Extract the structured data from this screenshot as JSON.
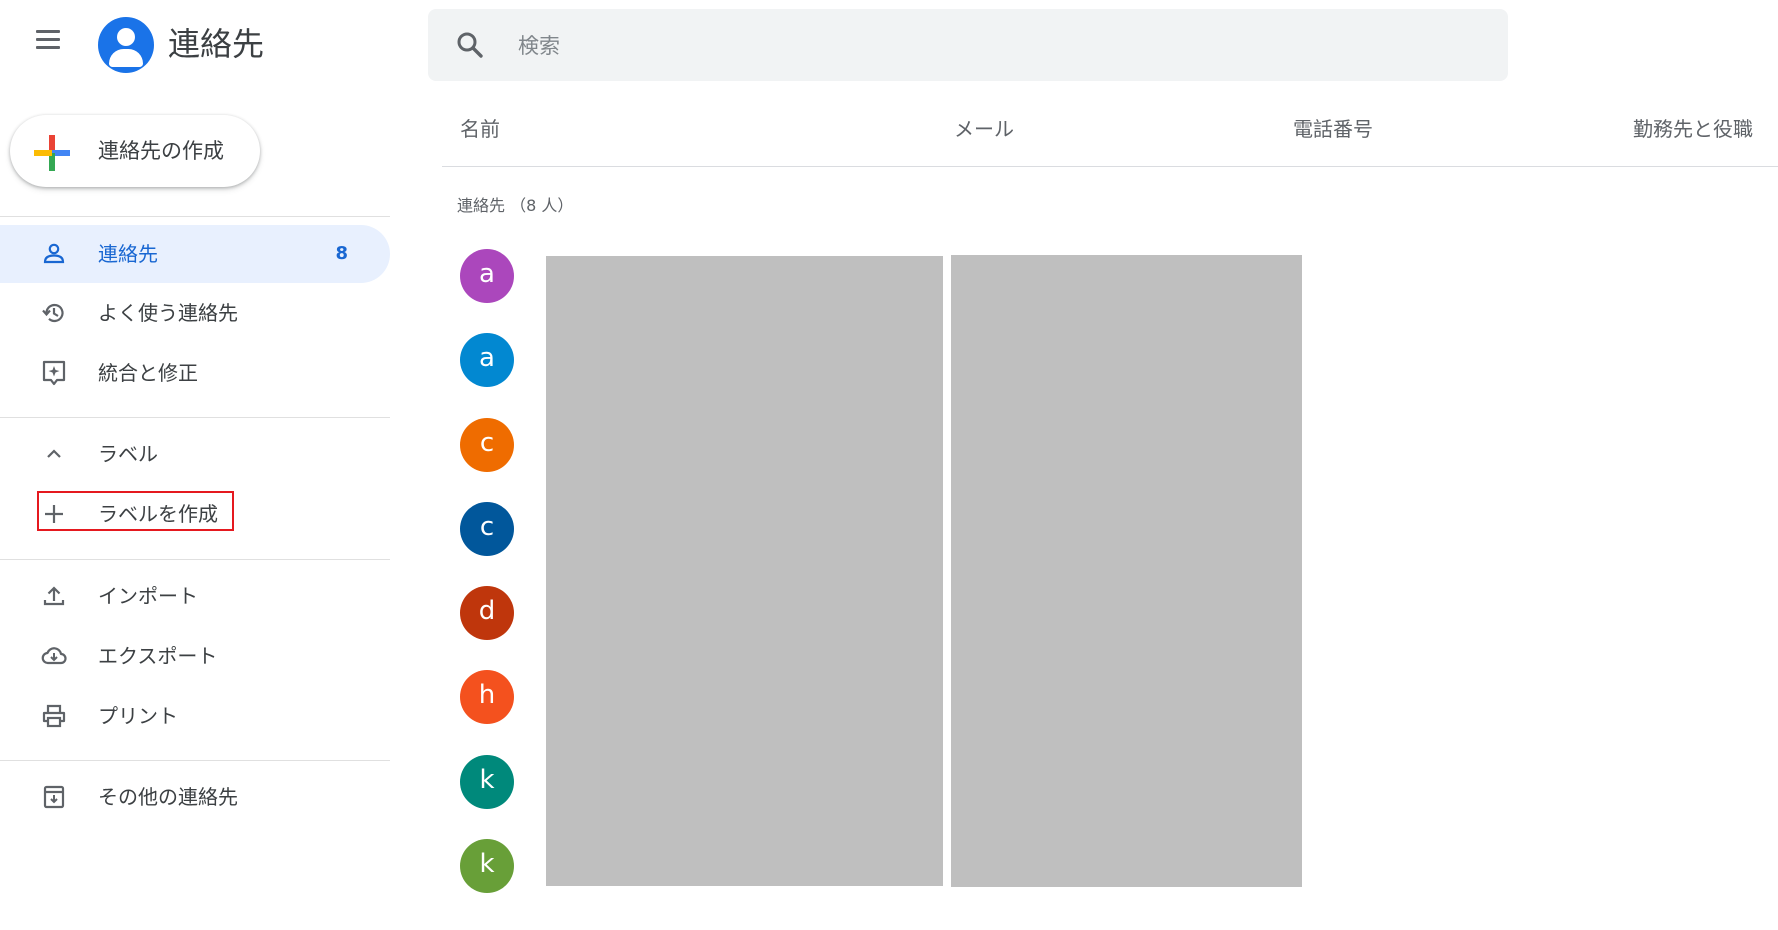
{
  "header": {
    "app_title": "連絡先",
    "menu_icon": "hamburger-menu-icon",
    "logo_icon": "contacts-logo-icon"
  },
  "create_button": {
    "label": "連絡先の作成",
    "icon": "multicolor-plus-icon"
  },
  "sidebar": {
    "main_items": [
      {
        "label": "連絡先",
        "count": "8",
        "icon": "person-icon",
        "active": true
      },
      {
        "label": "よく使う連絡先",
        "icon": "history-icon"
      },
      {
        "label": "統合と修正",
        "icon": "merge-fix-icon"
      }
    ],
    "labels_section": {
      "label": "ラベル",
      "icon": "chevron-up-icon",
      "create_label": "ラベルを作成",
      "create_icon": "plus-icon"
    },
    "actions": [
      {
        "label": "インポート",
        "icon": "upload-icon"
      },
      {
        "label": "エクスポート",
        "icon": "cloud-download-icon"
      },
      {
        "label": "プリント",
        "icon": "printer-icon"
      }
    ],
    "other": {
      "label": "その他の連絡先",
      "icon": "archive-icon"
    }
  },
  "search": {
    "placeholder": "検索",
    "value": "",
    "icon": "search-icon"
  },
  "table": {
    "columns": [
      "名前",
      "メール",
      "電話番号",
      "勤務先と役職"
    ],
    "section_title": "連絡先 （8 人）"
  },
  "contacts": [
    {
      "initial": "a",
      "color": "#ab47bc"
    },
    {
      "initial": "a",
      "color": "#0288d1"
    },
    {
      "initial": "c",
      "color": "#ef6c00"
    },
    {
      "initial": "c",
      "color": "#01579b"
    },
    {
      "initial": "d",
      "color": "#bf360c"
    },
    {
      "initial": "h",
      "color": "#f4511e"
    },
    {
      "initial": "k",
      "color": "#00897b"
    },
    {
      "initial": "k",
      "color": "#689f38"
    }
  ],
  "colors": {
    "accent": "#1a73e8",
    "active_bg": "#e8f0fe",
    "active_text": "#1967d2",
    "highlight_box": "#e5191f",
    "redaction": "#bfbfbf"
  }
}
